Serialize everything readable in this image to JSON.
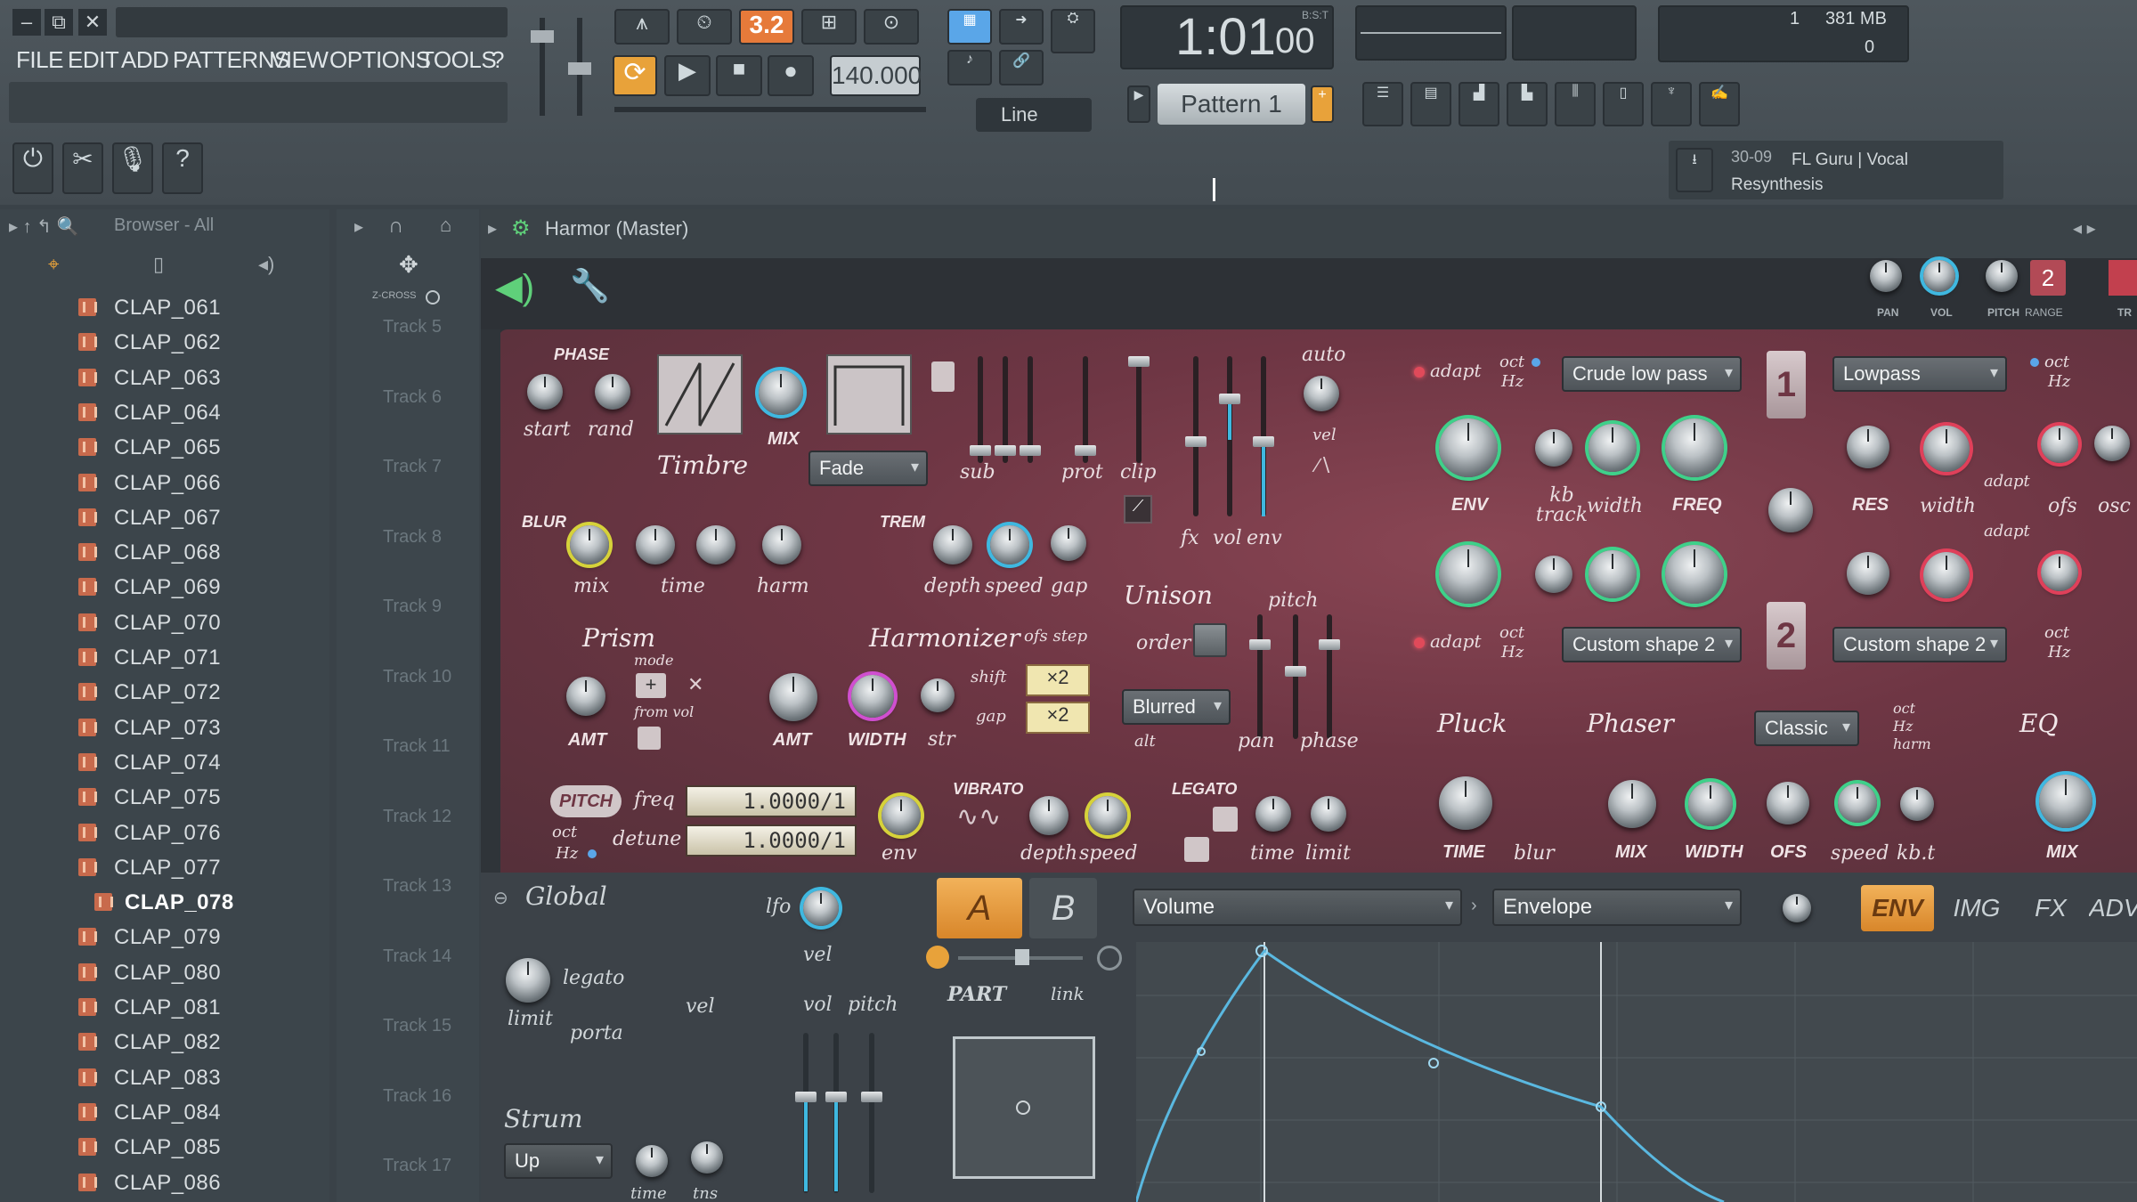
{
  "window": {
    "minimize": "–",
    "restore": "⧉",
    "close": "✕"
  },
  "menu": [
    "FILE",
    "EDIT",
    "ADD",
    "PATTERNS",
    "VIEW",
    "OPTIONS",
    "TOOLS",
    "?"
  ],
  "transport": {
    "pattern_mode": "3.2",
    "tempo": "140.000",
    "time_display": "1:01",
    "time_sub": "00",
    "time_unit": "B:S:T",
    "snap": "Line",
    "pattern": "Pattern 1"
  },
  "cpu": {
    "value": "1",
    "memory": "381 MB",
    "polyphony": "0"
  },
  "news": {
    "date": "30-09",
    "text": "FL Guru | Vocal Resynthesis"
  },
  "browser": {
    "title": "Browser - All"
  },
  "clips": [
    "CLAP_061",
    "CLAP_062",
    "CLAP_063",
    "CLAP_064",
    "CLAP_065",
    "CLAP_066",
    "CLAP_067",
    "CLAP_068",
    "CLAP_069",
    "CLAP_070",
    "CLAP_071",
    "CLAP_072",
    "CLAP_073",
    "CLAP_074",
    "CLAP_075",
    "CLAP_076",
    "CLAP_077",
    "CLAP_078",
    "CLAP_079",
    "CLAP_080",
    "CLAP_081",
    "CLAP_082",
    "CLAP_083",
    "CLAP_084",
    "CLAP_085",
    "CLAP_086"
  ],
  "selected_clip": "CLAP_078",
  "tracks": [
    "Track 5",
    "Track 6",
    "Track 7",
    "Track 8",
    "Track 9",
    "Track 10",
    "Track 11",
    "Track 12",
    "Track 13",
    "Track 14",
    "Track 15",
    "Track 16",
    "Track 17"
  ],
  "crossfade": "Z-CROSS",
  "plugin": {
    "title": "Harmor (Master)",
    "pan": "PAN",
    "vol": "VOL",
    "pitch": "PITCH",
    "range": "RANGE",
    "track": "TR",
    "channel": "2",
    "phase": "PHASE",
    "start": "start",
    "rand": "rand",
    "mix": "MIX",
    "timbre": "Timbre",
    "fade": "Fade",
    "sub": "sub",
    "prot": "prot",
    "clip": "clip",
    "fx": "fx",
    "vol_lbl": "vol",
    "env": "env",
    "auto": "auto",
    "vel": "vel",
    "blur": "BLUR",
    "blur_mix": "mix",
    "blur_time": "time",
    "harm": "harm",
    "trem": "TREM",
    "depth": "depth",
    "speed": "speed",
    "gap": "gap",
    "unison": "Unison",
    "order": "order",
    "unison_pitch": "pitch",
    "blurred": "Blurred",
    "alt": "alt",
    "pan_lbl": "pan",
    "phase_lbl": "phase",
    "prism": "Prism",
    "mode": "mode",
    "from_vol": "from vol",
    "amt": "AMT",
    "harmonizer": "Harmonizer",
    "ofs_step": "ofs step",
    "width": "WIDTH",
    "str": "str",
    "shift": "shift",
    "gap2": "gap",
    "x2a": "×2",
    "x2b": "×2",
    "pitch_btn": "PITCH",
    "oct": "oct",
    "hz": "Hz",
    "freq": "freq",
    "detune": "detune",
    "freq_val": "1.0000/1",
    "detune_val": "1.0000/1",
    "pitch_env": "env",
    "vibrato": "VIBRATO",
    "vib_depth": "depth",
    "vib_speed": "speed",
    "legato": "LEGATO",
    "leg_time": "time",
    "leg_limit": "limit",
    "f1_adapt": "adapt",
    "f1_type": "Crude low pass",
    "f1_env": "ENV",
    "kb_track": "kb track",
    "f1_width": "width",
    "f1_freq": "FREQ",
    "filter1": "1",
    "filter2": "2",
    "f2_type": "Lowpass",
    "res": "RES",
    "f2_width": "width",
    "f2_adapt": "adapt",
    "ofs": "ofs",
    "osc": "osc",
    "shape1": "Custom shape 2",
    "shape2": "Custom shape 2",
    "adapt2": "adapt",
    "pluck": "Pluck",
    "phaser": "Phaser",
    "phaser_mode": "Classic",
    "harm_lbl": "harm",
    "eq": "EQ",
    "pluck_time": "TIME",
    "pluck_blur": "blur",
    "ph_mix": "MIX",
    "ph_width": "WIDTH",
    "ph_ofs": "OFS",
    "ph_speed": "speed",
    "ph_kbt": "kb.t",
    "eq_mix": "MIX",
    "global": "Global",
    "lfo": "lfo",
    "legato_lbl": "legato",
    "vel_lbl": "vel",
    "limit": "limit",
    "porta": "porta",
    "g_vel": "vel",
    "g_vol": "vol",
    "g_pitch": "pitch",
    "part_a": "A",
    "part_b": "B",
    "part": "PART",
    "link": "link",
    "strum": "Strum",
    "strum_dir": "Up",
    "strum_time": "time",
    "strum_tns": "tns",
    "env_target": "Volume",
    "env_kind": "Envelope",
    "tab_env": "ENV",
    "tab_img": "IMG",
    "tab_fx": "FX",
    "tab_adv": "ADV"
  },
  "colors": {
    "accent": "#e8a23a",
    "synth_bg": "#6e3644",
    "knob_ring_green": "#3fd08a",
    "led_red": "#e04a5a"
  }
}
